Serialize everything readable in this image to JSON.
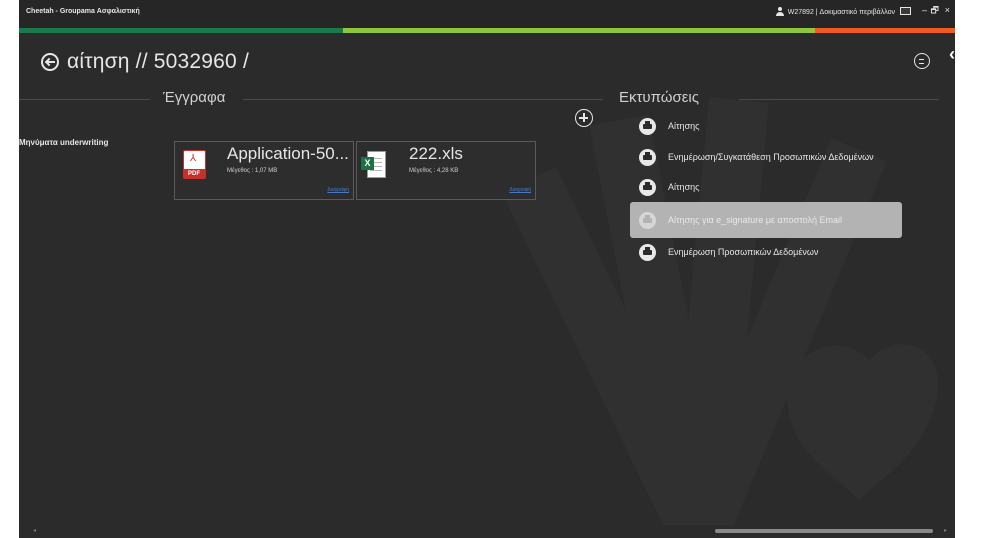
{
  "window": {
    "title": "Cheetah - Groupama Ασφαλιστική",
    "user": "W27892 | Δοκιμαστικό περιβάλλον",
    "controls": {
      "minimize": "–",
      "restore": "🗗",
      "close": "×"
    }
  },
  "colors": {
    "bar1": "#1a7a4b",
    "bar2": "#8ec63f",
    "bar3": "#f15a24",
    "background": "#2b2b2b",
    "selected": "#b3b3b3"
  },
  "header": {
    "title": "αίτηση // 5032960 /",
    "collapse_glyph": "‹"
  },
  "documents": {
    "section_title": "Έγγραφα",
    "underwriting_label": "Μηνύματα underwriting",
    "files": [
      {
        "name": "Application-50...",
        "size": "Μέγεθος : 1,07 MB",
        "link": "Διαγραφή",
        "icon": "pdf-icon"
      },
      {
        "name": "222.xls",
        "size": "Μέγεθος : 4,28 KB",
        "link": "Διαγραφή",
        "icon": "excel-icon"
      }
    ]
  },
  "prints": {
    "section_title": "Εκτυπώσεις",
    "items": [
      {
        "label": "Αίτησης",
        "selected": false
      },
      {
        "label": "Ενημέρωση/Συγκατάθεση Προσωπικών Δεδομένων",
        "selected": false
      },
      {
        "label": "Αίτησης",
        "selected": false
      },
      {
        "label": "Αίτησης για e_signature με  αποστολή Email",
        "selected": true
      },
      {
        "label": "Ενημέρωση Προσωπικών Δεδομένων",
        "selected": false
      }
    ]
  },
  "icons": {
    "back": "back-arrow-icon",
    "chat": "chat-icon",
    "add": "add-icon",
    "print": "printer-icon"
  }
}
